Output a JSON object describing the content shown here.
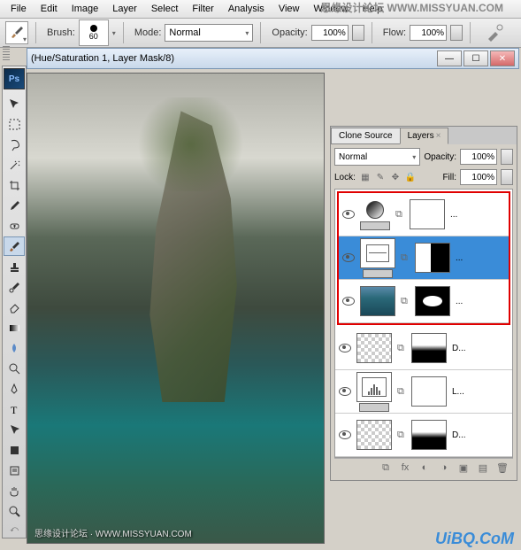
{
  "menu": {
    "file": "File",
    "edit": "Edit",
    "image": "Image",
    "layer": "Layer",
    "select": "Select",
    "filter": "Filter",
    "analysis": "Analysis",
    "view": "View",
    "window": "Window",
    "help": "Help"
  },
  "watermark_top": "思缘设计论坛  WWW.MISSYUAN.COM",
  "optbar": {
    "brush_label": "Brush:",
    "brush_size": "60",
    "mode_label": "Mode:",
    "mode_value": "Normal",
    "opacity_label": "Opacity:",
    "opacity_value": "100%",
    "flow_label": "Flow:",
    "flow_value": "100%"
  },
  "doc": {
    "title": "(Hue/Saturation 1, Layer Mask/8)"
  },
  "canvas_wm": "思缘设计论坛 · WWW.MISSYUAN.COM",
  "panels": {
    "tab_clone": "Clone Source",
    "tab_layers": "Layers",
    "blend_mode": "Normal",
    "opacity_label": "Opacity:",
    "opacity_value": "100%",
    "lock_label": "Lock:",
    "fill_label": "Fill:",
    "fill_value": "100%",
    "layers": [
      {
        "name": "...",
        "type": "hue-sat",
        "selected": false,
        "mask": "white",
        "in_red": true
      },
      {
        "name": "...",
        "type": "curves",
        "selected": true,
        "mask": "split",
        "in_red": true
      },
      {
        "name": "...",
        "type": "image-sea",
        "selected": false,
        "mask": "blob",
        "in_red": true
      },
      {
        "name": "D...",
        "type": "image-rock",
        "selected": false,
        "mask": "fade",
        "in_red": false
      },
      {
        "name": "L...",
        "type": "levels",
        "selected": false,
        "mask": "white",
        "in_red": false
      },
      {
        "name": "D...",
        "type": "image-checker",
        "selected": false,
        "mask": "fade",
        "in_red": false
      }
    ]
  },
  "corner_wm": "UiBQ.CoM",
  "ps_label": "Ps"
}
